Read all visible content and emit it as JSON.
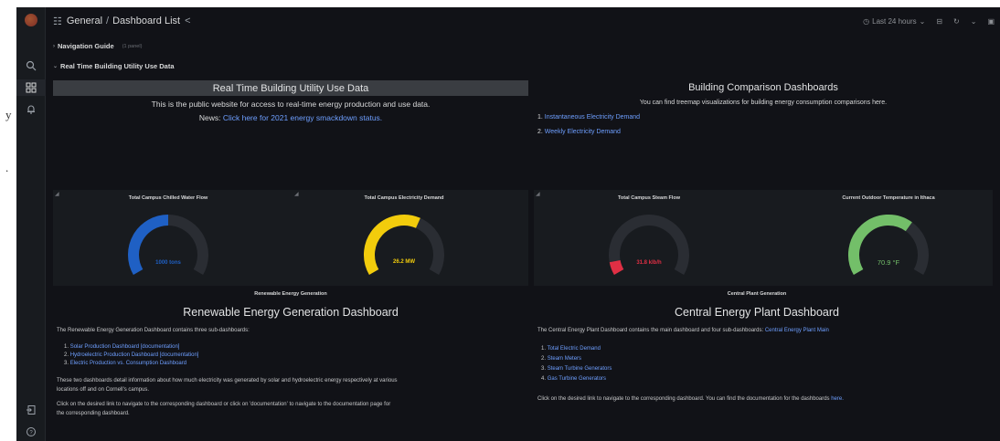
{
  "margin": {
    "texts": [
      "y",
      "."
    ]
  },
  "topbar": {
    "breadcrumb": [
      "General",
      "Dashboard List"
    ],
    "time_range": "Last 24 hours"
  },
  "rows": {
    "nav_guide": {
      "title": "Navigation Guide",
      "sub": "(1 panel)"
    },
    "realtime": {
      "title": "Real Time Building Utility Use Data"
    }
  },
  "intro_panel": {
    "heading": "Real Time Building Utility Use Data",
    "line1": "This is the public website for access to real-time energy production and use data.",
    "news_prefix": "News:",
    "news_link": "Click here for 2021 energy smackdown status."
  },
  "comparison_panel": {
    "heading": "Building Comparison Dashboards",
    "line1": "You can find treemap visualizations for building energy consumption comparisons here.",
    "items": [
      {
        "num": "1.",
        "label": "Instantaneous Electricity Demand"
      },
      {
        "num": "2.",
        "label": "Weekly Electricity Demand"
      }
    ]
  },
  "gauges": [
    {
      "title": "Total Campus Chilled Water Flow",
      "value": "1000 tons",
      "fraction": 0.5,
      "color": "#1f60c4"
    },
    {
      "title": "Total Campus Electricity Demand",
      "value": "26.2 MW",
      "fraction": 0.6,
      "color": "#f2cc0c"
    },
    {
      "title": "Total Campus Steam Flow",
      "value": "31.8 klb/h",
      "fraction": 0.08,
      "color": "#e02f44"
    },
    {
      "title": "Current Outdoor Temperature in Ithaca",
      "value": "70.9 °F",
      "fraction": 0.65,
      "color": "#73bf69"
    }
  ],
  "renewable": {
    "sub": "Renewable Energy Generation",
    "heading": "Renewable Energy Generation Dashboard",
    "intro": "The Renewable Energy Generation Dashboard contains three sub-dashboards:",
    "items": [
      {
        "num": "1.",
        "label": "Solar Production Dashboard",
        "doc": "[documentation]"
      },
      {
        "num": "2.",
        "label": "Hydroelectric Production Dashboard",
        "doc": "[documentation]"
      },
      {
        "num": "3.",
        "label": "Electric Production vs. Consumption Dashboard",
        "doc": ""
      }
    ],
    "para1a": "These two dashboards detail information about how much electricity was generated by solar and hydroelectric energy respectively at various",
    "para1b": "locations off and on Cornell's campus.",
    "para2a": "Click on the desired link to navigate to the corresponding dashboard or click on 'documentation' to navigate to the documentation page for",
    "para2b": "the corresponding dashboard."
  },
  "central": {
    "sub": "Central Plant Generation",
    "heading": "Central Energy Plant Dashboard",
    "intro": "The Central Energy Plant Dashboard contains the main dashboard and four sub-dashboards:",
    "intro_link": "Central Energy Plant Main",
    "items": [
      {
        "num": "1.",
        "label": "Total Electric Demand"
      },
      {
        "num": "2.",
        "label": "Steam Meters"
      },
      {
        "num": "3.",
        "label": "Steam Turbine Generators"
      },
      {
        "num": "4.",
        "label": "Gas Turbine Generators"
      }
    ],
    "footer": "Click on the desired link to navigate to the corresponding dashboard. You can find the documentation for the dashboards",
    "footer_link": "here."
  }
}
